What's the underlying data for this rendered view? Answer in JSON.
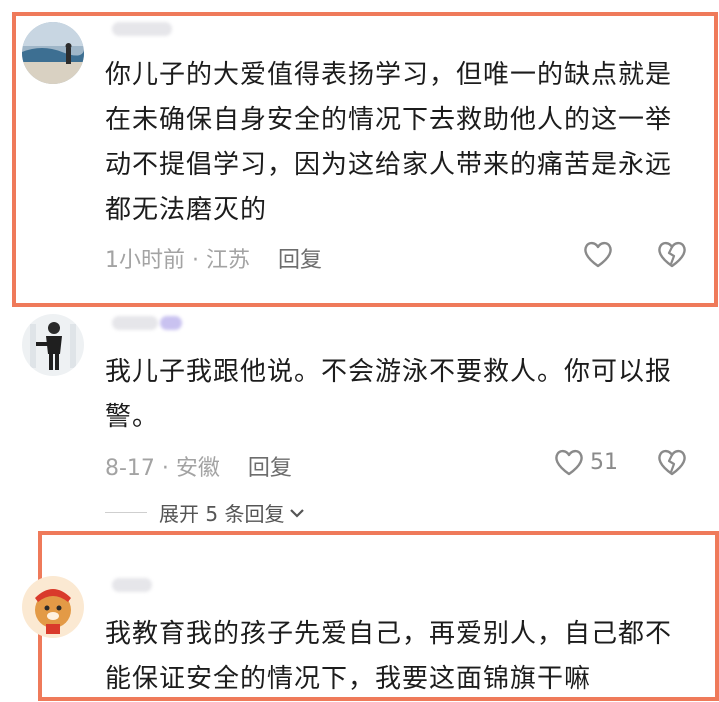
{
  "comments": [
    {
      "text_lines": [
        "你儿子的大爱值得表扬学习，但唯一的缺点就是",
        "在未确保自身安全的情况下去救助他人的这一举",
        "动不提倡学习，因为这给家人带来的痛苦是永远",
        "都无法磨灭的"
      ],
      "meta": "1小时前 · 江苏",
      "reply_label": "回复",
      "likes": ""
    },
    {
      "text_lines": [
        "我儿子我跟他说。不会游泳不要救人。你可以报",
        "警。"
      ],
      "meta": "8-17 · 安徽",
      "reply_label": "回复",
      "likes": "51",
      "expand_label": "展开 5 条回复"
    },
    {
      "text_lines": [
        "我教育我的孩子先爱自己，再爱别人，自己都不",
        "能保证安全的情况下，我要这面锦旗干嘛"
      ]
    }
  ],
  "icons": [
    "heart-icon",
    "dislike-heart-icon",
    "chevron-down-icon"
  ],
  "colors": {
    "highlight": "#ef7a5a",
    "meta": "#a3a3a3",
    "text": "#1c1c1c"
  }
}
